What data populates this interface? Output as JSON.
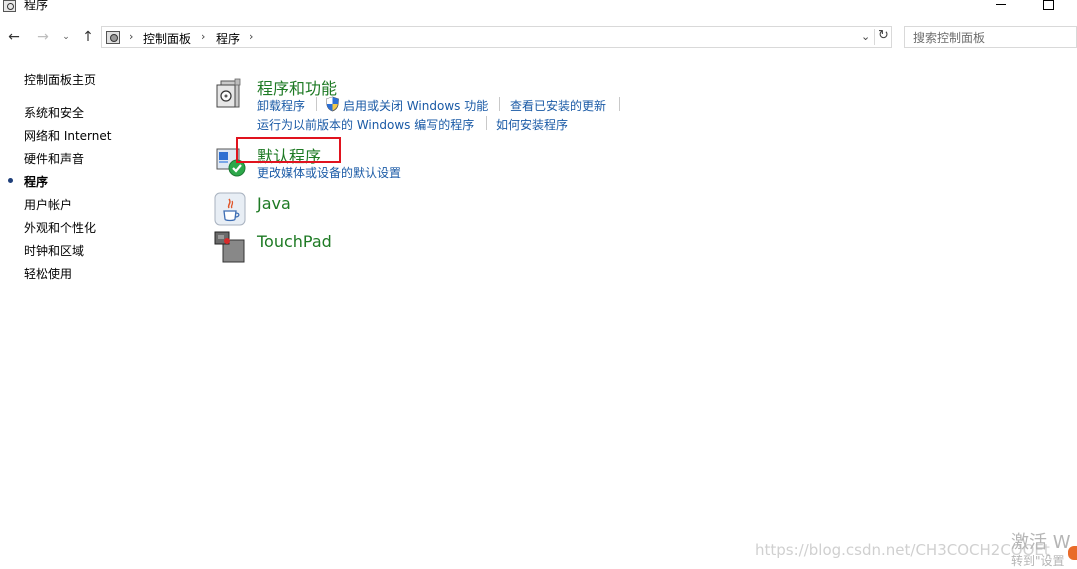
{
  "window": {
    "title": "程序"
  },
  "address_bar": {
    "breadcrumbs": [
      "控制面板",
      "程序"
    ],
    "dropdown_glyph": "⌄",
    "refresh_glyph": "↻"
  },
  "search": {
    "placeholder": "搜索控制面板"
  },
  "nav_buttons": {
    "back": "←",
    "forward": "→",
    "recent": "⌄",
    "up": "↑"
  },
  "left_nav": {
    "home": "控制面板主页",
    "items": [
      {
        "label": "系统和安全",
        "active": false
      },
      {
        "label": "网络和 Internet",
        "active": false
      },
      {
        "label": "硬件和声音",
        "active": false
      },
      {
        "label": "程序",
        "active": true
      },
      {
        "label": "用户帐户",
        "active": false
      },
      {
        "label": "外观和个性化",
        "active": false
      },
      {
        "label": "时钟和区域",
        "active": false
      },
      {
        "label": "轻松使用",
        "active": false
      }
    ]
  },
  "categories": [
    {
      "title": "程序和功能",
      "icon": "programs-features-icon",
      "links": [
        "卸载程序",
        "启用或关闭 Windows 功能",
        "查看已安装的更新",
        "运行为以前版本的 Windows 编写的程序",
        "如何安装程序"
      ]
    },
    {
      "title": "默认程序",
      "icon": "default-programs-icon",
      "links": [
        "更改媒体或设备的默认设置"
      ]
    },
    {
      "title": "Java",
      "icon": "java-icon",
      "links": []
    },
    {
      "title": "TouchPad",
      "icon": "touchpad-icon",
      "links": []
    }
  ],
  "watermarks": {
    "url": "https://blog.csdn.net/CH3COCH2COOEt",
    "activate": "激活 W",
    "activate_sub": "转到\"设置"
  },
  "colors": {
    "category_title": "#1e7a24",
    "link": "#1a5aa6",
    "highlight": "#e0131e"
  }
}
